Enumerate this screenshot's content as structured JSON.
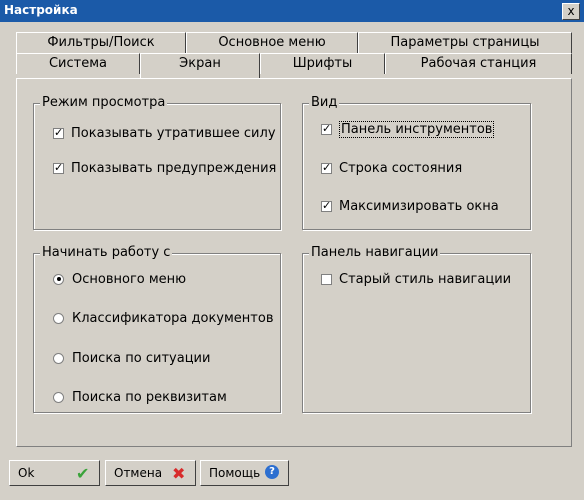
{
  "window": {
    "title": "Настройка",
    "close_label": "x"
  },
  "tabs_row1": [
    "Фильтры/Поиск",
    "Основное меню",
    "Параметры страницы"
  ],
  "tabs_row2": [
    "Система",
    "Экран",
    "Шрифты",
    "Рабочая станция"
  ],
  "active_tab": "Экран",
  "view_mode": {
    "title": "Режим просмотра",
    "items": [
      {
        "label": "Показывать утратившее силу",
        "checked": true
      },
      {
        "label": "Показывать предупреждения",
        "checked": true
      }
    ]
  },
  "view": {
    "title": "Вид",
    "items": [
      {
        "label": "Панель инструментов",
        "checked": true
      },
      {
        "label": "Строка состояния",
        "checked": true
      },
      {
        "label": "Максимизировать окна",
        "checked": true
      }
    ]
  },
  "start_with": {
    "title": "Начинать работу с",
    "options": [
      {
        "label": "Основного меню",
        "selected": true
      },
      {
        "label": "Классификатора документов",
        "selected": false
      },
      {
        "label": "Поиска по ситуации",
        "selected": false
      },
      {
        "label": "Поиска по реквизитам",
        "selected": false
      }
    ]
  },
  "nav_panel": {
    "title": "Панель навигации",
    "items": [
      {
        "label": "Старый стиль навигации",
        "checked": false
      }
    ]
  },
  "buttons": {
    "ok": "Ok",
    "cancel": "Отмена",
    "help": "Помощь"
  },
  "icons": {
    "ok": "green-check-icon",
    "cancel": "red-x-icon",
    "help": "blue-question-icon"
  },
  "colors": {
    "titlebar": "#1b5aa8",
    "face": "#d4d0c8",
    "ok_icon": "#3aa33a",
    "cancel_icon": "#d82b2b",
    "help_icon": "#2d6fd0"
  }
}
